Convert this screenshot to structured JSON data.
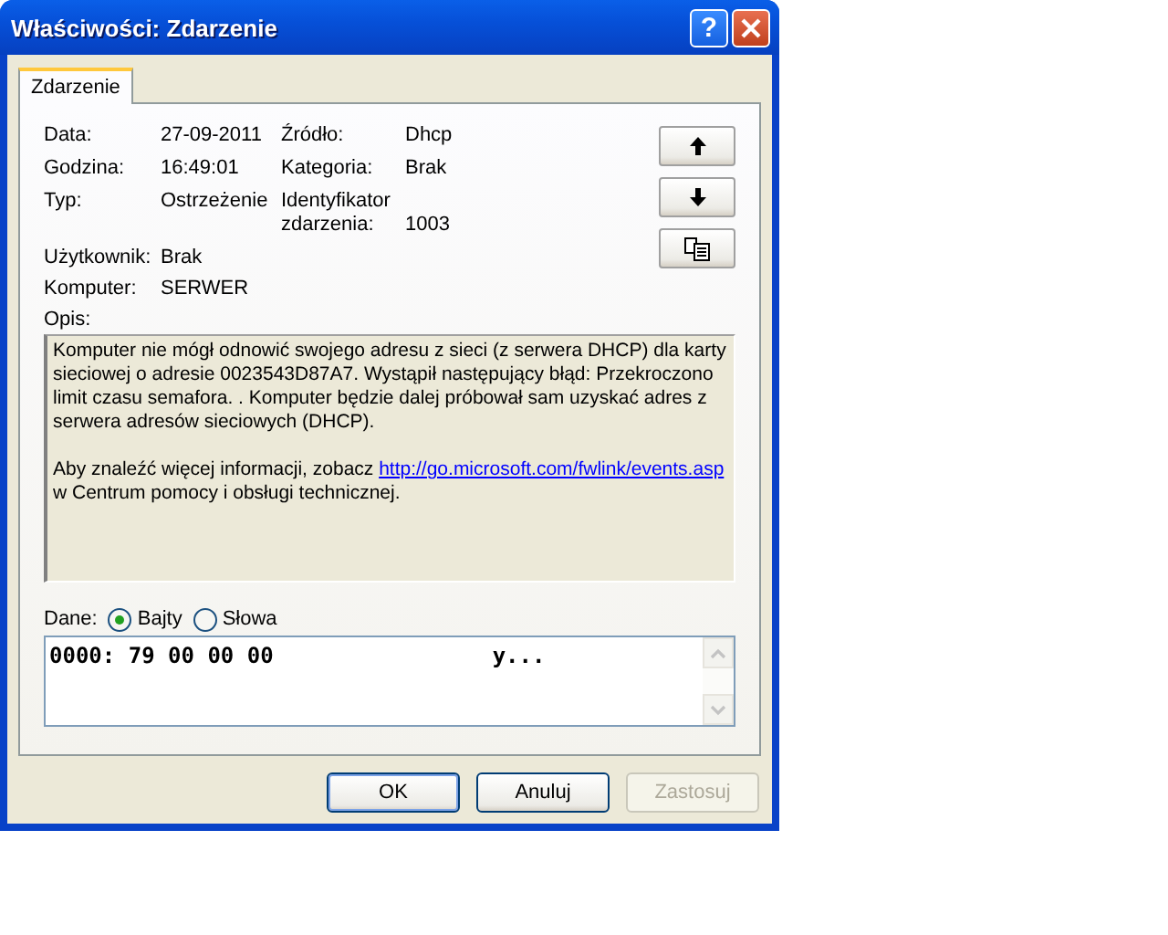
{
  "window": {
    "title": "Właściwości: Zdarzenie",
    "controls": [
      {
        "kind": "help",
        "label": "?"
      },
      {
        "kind": "close"
      }
    ]
  },
  "tabs": [
    {
      "label": "Zdarzenie",
      "selected": true
    }
  ],
  "fields_left": [
    {
      "label": "Data:",
      "value": "27-09-2011"
    },
    {
      "label": "Godzina:",
      "value": "16:49:01"
    },
    {
      "label": "Typ:",
      "value": "Ostrzeżenie"
    }
  ],
  "fields_right": [
    {
      "label": "Źródło:",
      "value": "Dhcp"
    },
    {
      "label": "Kategoria:",
      "value": "Brak"
    },
    {
      "label": "Identyfikator zdarzenia:",
      "value": "1003"
    }
  ],
  "fields_bottom": [
    {
      "label": "Użytkownik:",
      "value": "Brak"
    },
    {
      "label": "Komputer:",
      "value": "SERWER"
    }
  ],
  "side_buttons": [
    {
      "kind": "up"
    },
    {
      "kind": "down"
    },
    {
      "kind": "copy"
    }
  ],
  "description": {
    "label": "Opis:",
    "paragraphs": [
      {
        "text": "Komputer nie mógł odnowić swojego adresu z sieci (z serwera DHCP) dla karty sieciowej o adresie 0023543D87A7. Wystąpił następujący błąd: Przekroczono limit czasu semafora. . Komputer będzie dalej próbował sam uzyskać adres z serwera adresów sieciowych (DHCP)."
      },
      {
        "text": "Aby znaleźć więcej informacji, zobacz",
        "link": "http://go.microsoft.com/fwlink/events.asp",
        "after": "w Centrum pomocy i obsługi technicznej."
      }
    ]
  },
  "data": {
    "label": "Dane:",
    "options": [
      {
        "label": "Bajty",
        "selected": true
      },
      {
        "label": "Słowa",
        "selected": false
      }
    ],
    "hex": "0000: 79 00 00 00",
    "ascii": "y..."
  },
  "buttons": [
    {
      "label": "OK",
      "default": true,
      "disabled": false
    },
    {
      "label": "Anuluj",
      "default": false,
      "disabled": false
    },
    {
      "label": "Zastosuj",
      "default": false,
      "disabled": true
    }
  ]
}
